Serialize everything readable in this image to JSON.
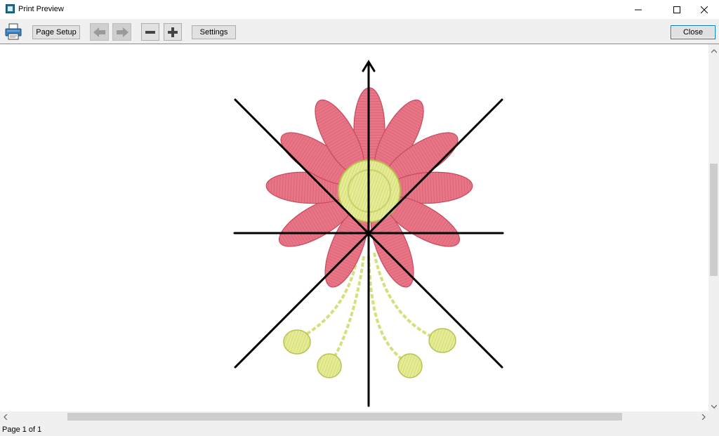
{
  "window": {
    "title": "Print Preview",
    "app_icon": "app-logo-icon",
    "controls": [
      "minimize-icon",
      "maximize-icon",
      "close-icon"
    ]
  },
  "toolbar": {
    "print_icon": "printer-icon",
    "page_setup_label": "Page Setup",
    "prev_icon": "arrow-left-icon",
    "next_icon": "arrow-right-icon",
    "zoom_out_icon": "minus-icon",
    "zoom_in_icon": "plus-icon",
    "settings_label": "Settings",
    "close_label": "Close"
  },
  "preview": {
    "content": "embroidery-flower-design",
    "colors": {
      "petal": "#e87586",
      "petal_dark": "#c9485d",
      "center": "#e6ec95",
      "center_dark": "#b9c24f",
      "stem": "#d6e07a",
      "guide_lines": "#000000"
    }
  },
  "status": {
    "page_text": "Page 1 of 1"
  }
}
